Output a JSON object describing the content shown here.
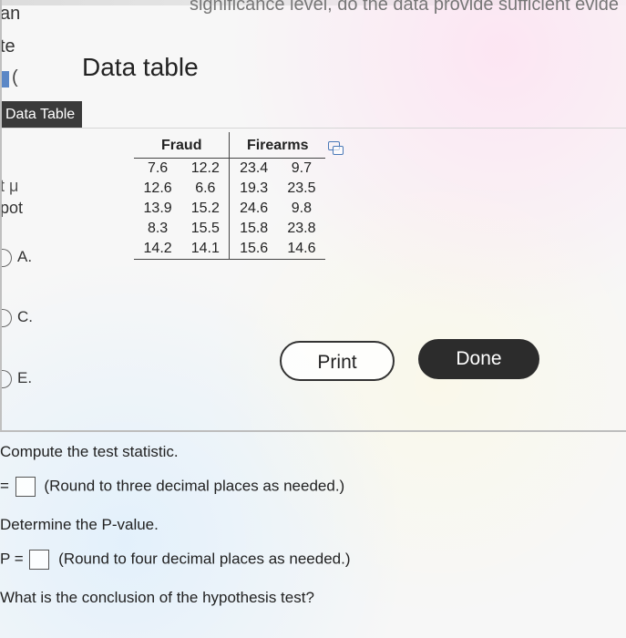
{
  "background": {
    "top_right_text": "significance level, do the data provide sufficient evide",
    "left_fragments": {
      "an": "an",
      "te": "te",
      "t_mu": "t μ",
      "pot": "pot"
    },
    "options": {
      "a": "A.",
      "c": "C.",
      "e": "E."
    }
  },
  "dialog": {
    "title": "Data table",
    "tab_label": "Data Table",
    "table": {
      "headers": [
        "Fraud",
        "Firearms"
      ],
      "rows": [
        [
          "7.6",
          "12.2",
          "23.4",
          "9.7"
        ],
        [
          "12.6",
          "6.6",
          "19.3",
          "23.5"
        ],
        [
          "13.9",
          "15.2",
          "24.6",
          "9.8"
        ],
        [
          "8.3",
          "15.5",
          "15.8",
          "23.8"
        ],
        [
          "14.2",
          "14.1",
          "15.6",
          "14.6"
        ]
      ]
    },
    "buttons": {
      "print": "Print",
      "done": "Done"
    }
  },
  "questions": {
    "compute": "Compute the test statistic.",
    "t_prefix": "=",
    "t_note": "(Round to three decimal places as needed.)",
    "determine": "Determine the P-value.",
    "p_prefix": "P =",
    "p_note": "(Round to four decimal places as needed.)",
    "conclusion": "What is the conclusion of the hypothesis test?"
  }
}
